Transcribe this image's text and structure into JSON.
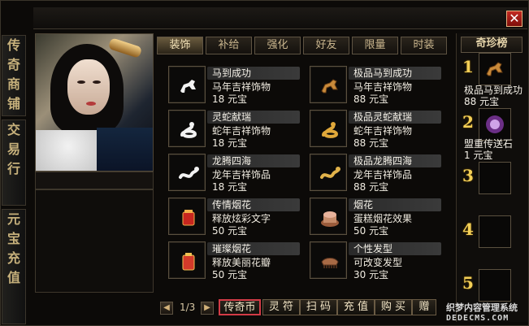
{
  "window": {
    "close_symbol": "✕"
  },
  "left_tabs": [
    {
      "label": "传\n奇\n商\n铺"
    },
    {
      "label": "交\n易\n行"
    },
    {
      "label": "元\n宝\n充\n值"
    }
  ],
  "tabs": [
    {
      "label": "装饰",
      "active": true
    },
    {
      "label": "补给"
    },
    {
      "label": "强化"
    },
    {
      "label": "好友"
    },
    {
      "label": "限量"
    },
    {
      "label": "时装"
    }
  ],
  "items": [
    {
      "name": "马到成功",
      "desc": "马年吉祥饰物",
      "price": "18 元宝",
      "icon": "white-horse-icon"
    },
    {
      "name": "极品马到成功",
      "desc": "马年吉祥饰物",
      "price": "88 元宝",
      "icon": "gold-horse-icon"
    },
    {
      "name": "灵蛇献瑞",
      "desc": "蛇年吉祥饰物",
      "price": "18 元宝",
      "icon": "white-snake-icon"
    },
    {
      "name": "极品灵蛇献瑞",
      "desc": "蛇年吉祥饰物",
      "price": "88 元宝",
      "icon": "gold-snake-icon"
    },
    {
      "name": "龙腾四海",
      "desc": "龙年吉祥饰品",
      "price": "18 元宝",
      "icon": "white-dragon-icon"
    },
    {
      "name": "极品龙腾四海",
      "desc": "龙年吉祥饰品",
      "price": "88 元宝",
      "icon": "gold-dragon-icon"
    },
    {
      "name": "传情烟花",
      "desc": "释放炫彩文字",
      "price": "50 元宝",
      "icon": "red-firework-icon"
    },
    {
      "name": "烟花",
      "desc": "蛋糕烟花效果",
      "price": "50 元宝",
      "icon": "cake-firework-icon"
    },
    {
      "name": "璀璨烟花",
      "desc": "释放美丽花瓣",
      "price": "50 元宝",
      "icon": "petal-firework-icon"
    },
    {
      "name": "个性发型",
      "desc": "可改变发型",
      "price": "30 元宝",
      "icon": "comb-icon"
    }
  ],
  "ranking": {
    "title": "奇珍榜",
    "entries": [
      {
        "rank": "1",
        "name": "极品马到成功",
        "price": "88 元宝",
        "icon": "gold-horse-icon"
      },
      {
        "rank": "2",
        "name": "盟重传送石",
        "price": "1 元宝",
        "icon": "purple-stone-icon"
      },
      {
        "rank": "3",
        "name": "",
        "price": ""
      },
      {
        "rank": "4",
        "name": "",
        "price": ""
      },
      {
        "rank": "5",
        "name": "",
        "price": ""
      }
    ]
  },
  "pager": {
    "text": "1/3",
    "prev": "◀",
    "next": "▶"
  },
  "buttons": [
    {
      "label": "传奇币",
      "selected": true
    },
    {
      "label": "灵 符"
    },
    {
      "label": "扫 码"
    },
    {
      "label": "充 值"
    },
    {
      "label": "购 买"
    },
    {
      "label": "赠"
    }
  ],
  "watermark": {
    "line1": "织梦内容管理系统",
    "line2": "DEDECMS.COM"
  }
}
